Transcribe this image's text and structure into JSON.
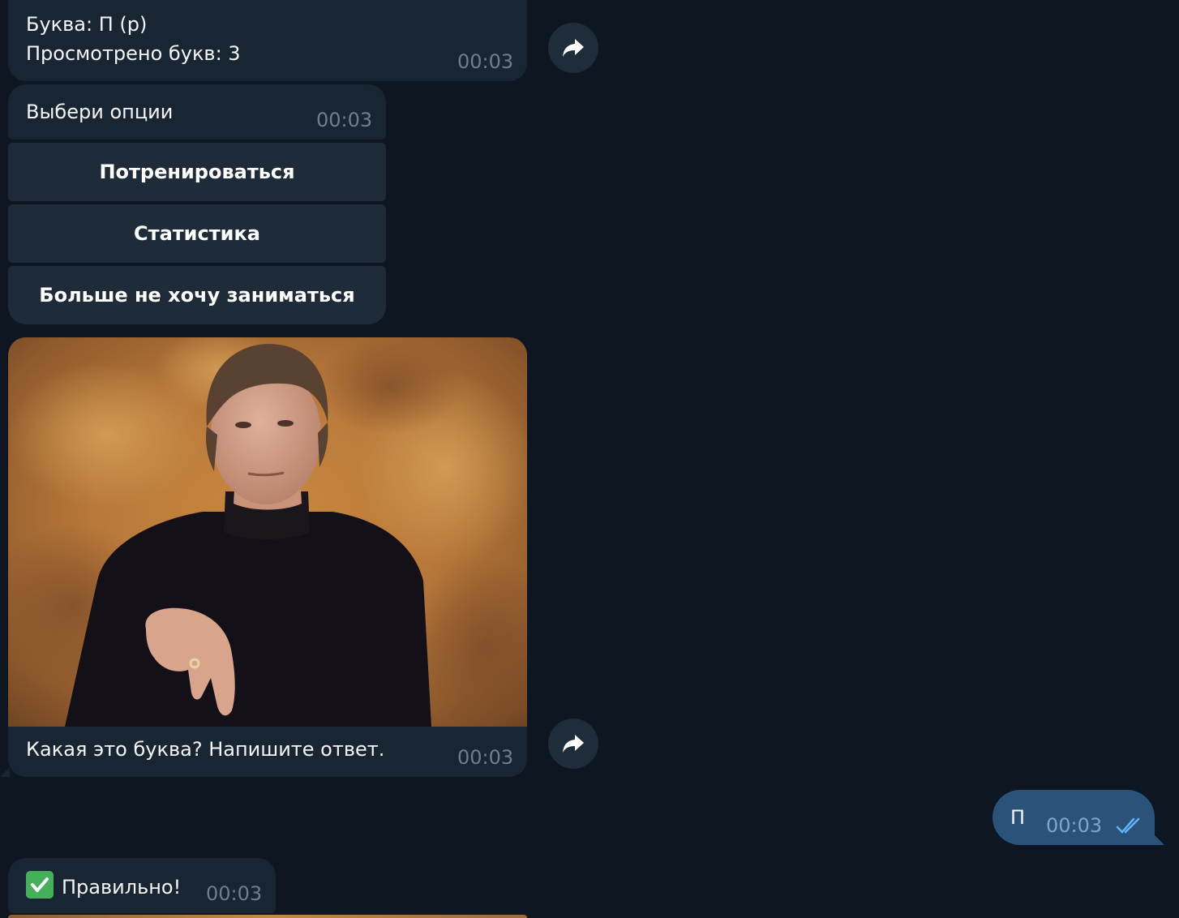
{
  "messages": {
    "letter_card": {
      "line1": "Буква: П (р)",
      "line2": "Просмотрено букв: 3",
      "time": "00:03"
    },
    "options_prompt": {
      "text": "Выбери опции",
      "time": "00:03"
    },
    "keyboard": {
      "buttons": [
        "Потренироваться",
        "Статистика",
        "Больше не хочу заниматься"
      ]
    },
    "photo_message": {
      "caption": "Какая это буква? Напишите ответ.",
      "time": "00:03"
    },
    "user_reply": {
      "text": "П",
      "time": "00:03",
      "status": "read"
    },
    "result": {
      "emoji": "✅",
      "text": "Правильно!",
      "time": "00:03"
    }
  },
  "icons": {
    "forward": "forward-icon",
    "read_status": "double-check-icon"
  },
  "colors": {
    "background": "#0e1621",
    "incoming_bubble": "#182533",
    "outgoing_bubble": "#2b5278",
    "keyboard_button": "#1e2c3a",
    "timestamp": "#6d7f8f",
    "check_accent": "#5eb5f7"
  }
}
